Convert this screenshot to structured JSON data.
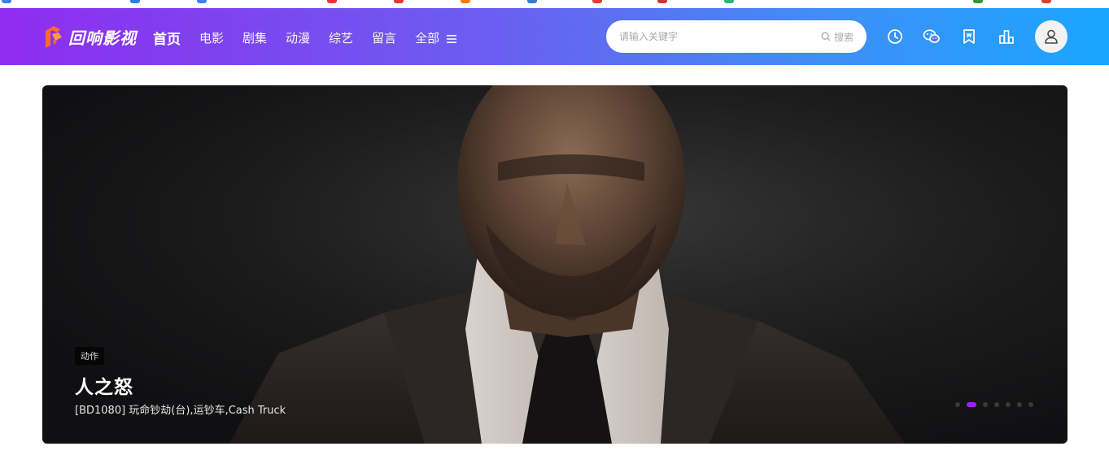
{
  "site": {
    "logo_text": "回响影视"
  },
  "nav": {
    "items": [
      {
        "label": "首页",
        "active": true
      },
      {
        "label": "电影"
      },
      {
        "label": "剧集"
      },
      {
        "label": "动漫"
      },
      {
        "label": "综艺"
      },
      {
        "label": "留言"
      },
      {
        "label": "全部"
      }
    ]
  },
  "search": {
    "placeholder": "请输入关键字",
    "button_label": "搜索"
  },
  "header_icons": [
    "history-icon",
    "wechat-icon",
    "bookmark-icon",
    "ranking-icon",
    "user-icon"
  ],
  "banner": {
    "tag": "动作",
    "title": "人之怒",
    "subtitle": "[BD1080] 玩命钞劫(台),运钞车,Cash Truck",
    "slides": 7,
    "active_slide": 1
  },
  "colors": {
    "header_gradient_start": "#8f2cf0",
    "header_gradient_end": "#19a6ff",
    "accent": "#a020f0"
  }
}
